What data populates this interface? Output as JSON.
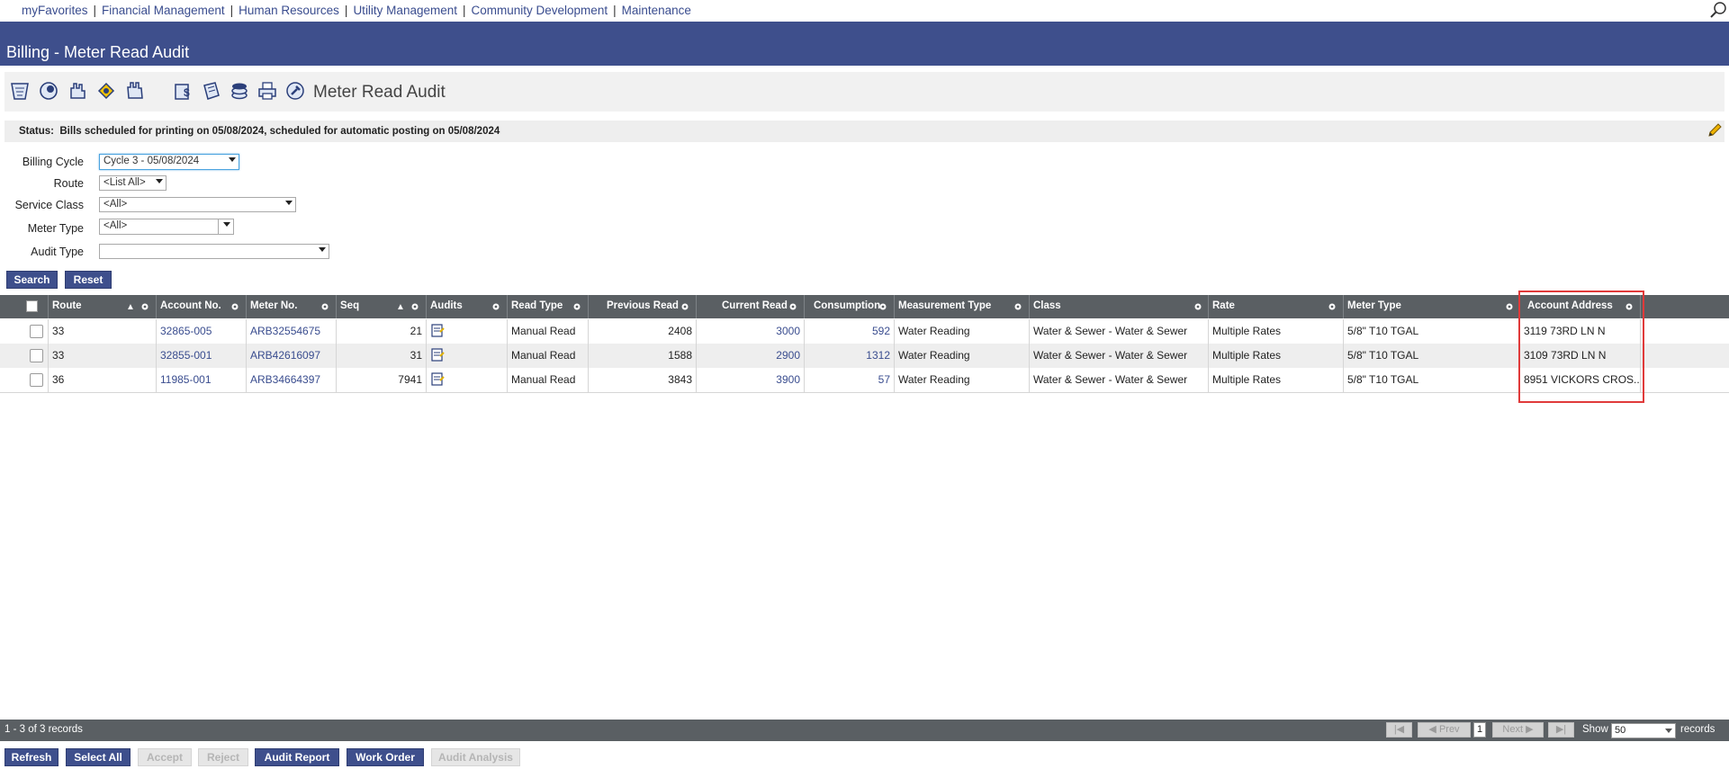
{
  "topnav": {
    "links": [
      "myFavorites",
      "Financial Management",
      "Human Resources",
      "Utility Management",
      "Community Development",
      "Maintenance"
    ],
    "separator": "|"
  },
  "page_title": "Billing - Meter Read Audit",
  "toolbar": {
    "title": "Meter Read Audit",
    "icons": [
      "list-icon",
      "globe-icon",
      "hand-icon",
      "coin-icon",
      "stop-hand-icon",
      "dollar-icon",
      "scroll-icon",
      "stack-icon",
      "printer-icon",
      "wrench-icon"
    ]
  },
  "status": {
    "label": "Status:",
    "text": "Bills scheduled for printing on 05/08/2024, scheduled for automatic posting on 05/08/2024"
  },
  "filters": {
    "billing_cycle": {
      "label": "Billing Cycle",
      "value": "Cycle 3 - 05/08/2024"
    },
    "route": {
      "label": "Route",
      "value": "<List All>"
    },
    "service_class": {
      "label": "Service Class",
      "value": "<All>"
    },
    "meter_type": {
      "label": "Meter Type",
      "value": "<All>"
    },
    "audit_type": {
      "label": "Audit Type",
      "value": ""
    }
  },
  "buttons": {
    "search": "Search",
    "reset": "Reset"
  },
  "grid": {
    "columns": [
      "Route",
      "Account No.",
      "Meter No.",
      "Seq",
      "Audits",
      "Read Type",
      "Previous Read",
      "Current Read",
      "Consumption",
      "Measurement Type",
      "Class",
      "Rate",
      "Meter Type",
      "Account Address"
    ],
    "rows": [
      {
        "route": "33",
        "account": "32865-005",
        "meter": "ARB32554675",
        "seq": "21",
        "read_type": "Manual Read",
        "prev": "2408",
        "curr": "3000",
        "cons": "592",
        "mtype": "Water Reading",
        "class": "Water & Sewer - Water & Sewer",
        "rate": "Multiple Rates",
        "meter_type": "5/8\" T10 TGAL",
        "address": "3119 73RD LN N"
      },
      {
        "route": "33",
        "account": "32855-001",
        "meter": "ARB42616097",
        "seq": "31",
        "read_type": "Manual Read",
        "prev": "1588",
        "curr": "2900",
        "cons": "1312",
        "mtype": "Water Reading",
        "class": "Water & Sewer - Water & Sewer",
        "rate": "Multiple Rates",
        "meter_type": "5/8\" T10 TGAL",
        "address": "3109 73RD LN N"
      },
      {
        "route": "36",
        "account": "11985-001",
        "meter": "ARB34664397",
        "seq": "7941",
        "read_type": "Manual Read",
        "prev": "3843",
        "curr": "3900",
        "cons": "57",
        "mtype": "Water Reading",
        "class": "Water & Sewer - Water & Sewer",
        "rate": "Multiple Rates",
        "meter_type": "5/8\" T10 TGAL",
        "address": "8951 VICKORS CROS..."
      }
    ]
  },
  "footer": {
    "record_count": "1 - 3 of 3 records",
    "prev": "Prev",
    "next": "Next",
    "page": "1",
    "show_label": "Show",
    "show_value": "50",
    "records_label": "records"
  },
  "bottom_buttons": {
    "refresh": "Refresh",
    "select_all": "Select All",
    "accept": "Accept",
    "reject": "Reject",
    "audit_report": "Audit Report",
    "work_order": "Work Order",
    "audit_analysis": "Audit Analysis"
  },
  "colors": {
    "brand": "#3e4f8c",
    "grid_header": "#5a5f63",
    "highlight": "#e03a3a",
    "link": "#3a4d8f"
  }
}
